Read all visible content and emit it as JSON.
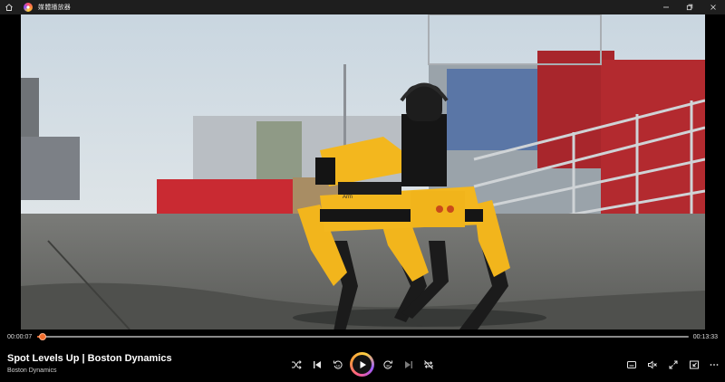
{
  "window": {
    "title": "媒體播放器",
    "icons": {
      "home": "home-icon",
      "app": "media-player-app-icon",
      "minimize": "minimize-icon",
      "restore": "restore-icon",
      "close": "close-icon"
    }
  },
  "player": {
    "current_time": "00:00:07",
    "total_time": "00:13:33",
    "progress": 0.009,
    "accent_color": "#f26b2a"
  },
  "media": {
    "title": "Spot Levels Up | Boston Dynamics",
    "artist": "Boston Dynamics"
  },
  "video_frame": {
    "robot_label": "Arm",
    "subject": "yellow quadruped robot"
  },
  "buttons": {
    "shuffle": "shuffle-icon",
    "previous": "previous-icon",
    "rewind": "rewind-10-icon",
    "play": "play-icon",
    "forward": "forward-30-icon",
    "next": "next-icon",
    "repeat": "repeat-off-icon",
    "captions": "captions-icon",
    "volume": "volume-mute-icon",
    "fullscreen": "fullscreen-icon",
    "miniplayer": "miniplayer-icon",
    "more": "more-icon"
  }
}
